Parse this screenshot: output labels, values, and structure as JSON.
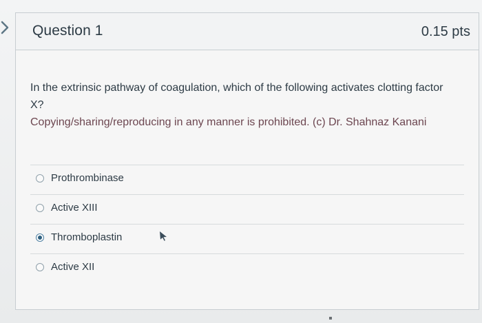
{
  "question": {
    "title": "Question 1",
    "points": "0.15 pts",
    "prompt": "In the extrinsic pathway of coagulation, which of the following activates clotting factor X?",
    "copyright": "Copying/sharing/reproducing in any manner is prohibited. (c) Dr. Shahnaz Kanani"
  },
  "answers": [
    {
      "label": "Prothrombinase",
      "selected": false
    },
    {
      "label": "Active XIII",
      "selected": false
    },
    {
      "label": "Thromboplastin",
      "selected": true
    },
    {
      "label": "Active XII",
      "selected": false
    }
  ],
  "colors": {
    "text": "#2d3b45",
    "copyright": "#6c4650",
    "border": "#c7cdd1",
    "selected_radio": "#2f5f7f"
  },
  "icons": {
    "nav": "nav-arrow-icon",
    "cursor": "mouse-pointer-icon"
  }
}
